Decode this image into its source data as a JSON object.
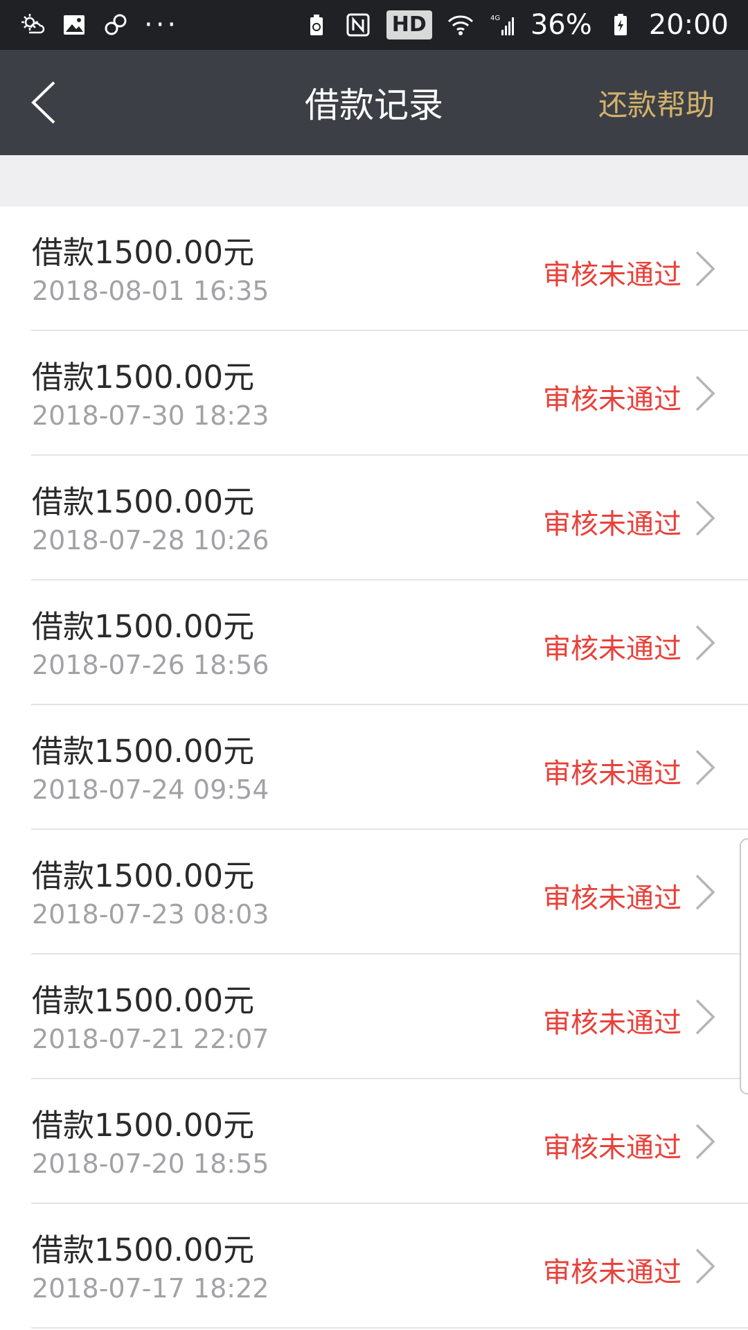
{
  "status_bar": {
    "icons_left": [
      "weather-icon",
      "gallery-icon",
      "link-icon"
    ],
    "more_dots": "···",
    "hd_label": "HD",
    "network_label": "4G",
    "battery_percent": "36%",
    "time": "20:00"
  },
  "header": {
    "title": "借款记录",
    "action_label": "还款帮助"
  },
  "colors": {
    "header_bg": "#3c4046",
    "status_bar_bg": "#1f2124",
    "accent_gold": "#d4b26c",
    "status_red": "#e8413a",
    "date_gray": "#a2a2a6",
    "page_gap": "#efeff2"
  },
  "records": [
    {
      "amount": "借款1500.00元",
      "date": "2018-08-01 16:35",
      "status": "审核未通过"
    },
    {
      "amount": "借款1500.00元",
      "date": "2018-07-30 18:23",
      "status": "审核未通过"
    },
    {
      "amount": "借款1500.00元",
      "date": "2018-07-28 10:26",
      "status": "审核未通过"
    },
    {
      "amount": "借款1500.00元",
      "date": "2018-07-26 18:56",
      "status": "审核未通过"
    },
    {
      "amount": "借款1500.00元",
      "date": "2018-07-24 09:54",
      "status": "审核未通过"
    },
    {
      "amount": "借款1500.00元",
      "date": "2018-07-23 08:03",
      "status": "审核未通过"
    },
    {
      "amount": "借款1500.00元",
      "date": "2018-07-21 22:07",
      "status": "审核未通过"
    },
    {
      "amount": "借款1500.00元",
      "date": "2018-07-20 18:55",
      "status": "审核未通过"
    },
    {
      "amount": "借款1500.00元",
      "date": "2018-07-17 18:22",
      "status": "审核未通过"
    }
  ]
}
